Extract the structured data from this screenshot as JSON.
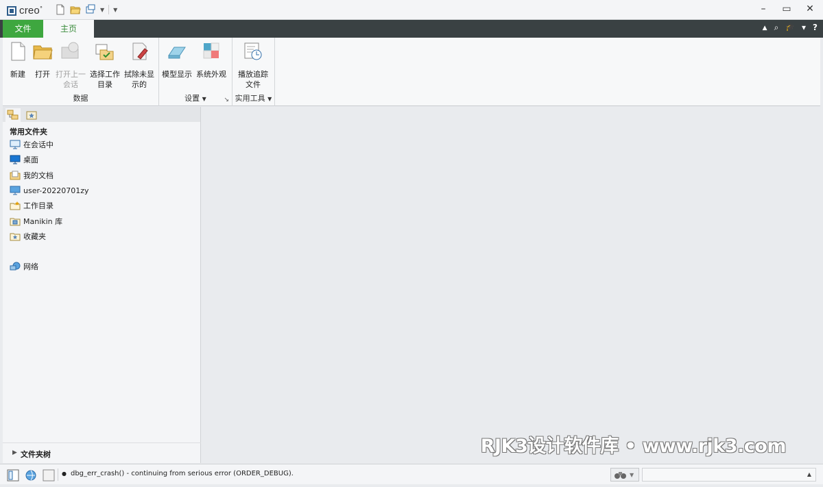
{
  "title_bar": {
    "app_name": "creo",
    "app_mark": "°",
    "window_controls": [
      "–",
      "▭",
      "✕"
    ]
  },
  "tabs": {
    "file": "文件",
    "home": "主页"
  },
  "tabbar_icons": [
    "▲",
    "⌕",
    "🎓",
    "▾",
    "?"
  ],
  "ribbon": {
    "groups": {
      "data": {
        "label": "数据",
        "buttons": {
          "new": {
            "line1": "新建",
            "line2": ""
          },
          "open": {
            "line1": "打开",
            "line2": ""
          },
          "open_last_session": {
            "line1": "打开上一",
            "line2": "会话"
          },
          "select_working_dir": {
            "line1": "选择工作",
            "line2": "目录"
          },
          "erase_not_displayed": {
            "line1": "拭除未显",
            "line2": "示的"
          }
        }
      },
      "settings": {
        "label": "设置",
        "buttons": {
          "model_display": {
            "line1": "模型显示"
          },
          "system_appearance": {
            "line1": "系统外观"
          }
        }
      },
      "utilities": {
        "label": "实用工具",
        "buttons": {
          "play_trail_file": {
            "line1": "播放追踪",
            "line2": "文件"
          }
        }
      }
    }
  },
  "navigator": {
    "heading": "常用文件夹",
    "items": [
      {
        "label": "在会话中",
        "icon": "monitor-icon"
      },
      {
        "label": "桌面",
        "icon": "desktop-icon"
      },
      {
        "label": "我的文档",
        "icon": "documents-icon"
      },
      {
        "label": "user-20220701zy",
        "icon": "computer-icon"
      },
      {
        "label": "工作目录",
        "icon": "working-folder-icon"
      },
      {
        "label": "Manikin 库",
        "icon": "library-icon"
      },
      {
        "label": "收藏夹",
        "icon": "favorites-icon"
      },
      {
        "label": "网络",
        "icon": "network-icon"
      }
    ],
    "folder_tree_label": "文件夹树"
  },
  "watermark": "RJK3设计软件库 • www.rjk3.com",
  "status_bar": {
    "message": "dbg_err_crash() - continuing from serious error (ORDER_DEBUG)."
  }
}
